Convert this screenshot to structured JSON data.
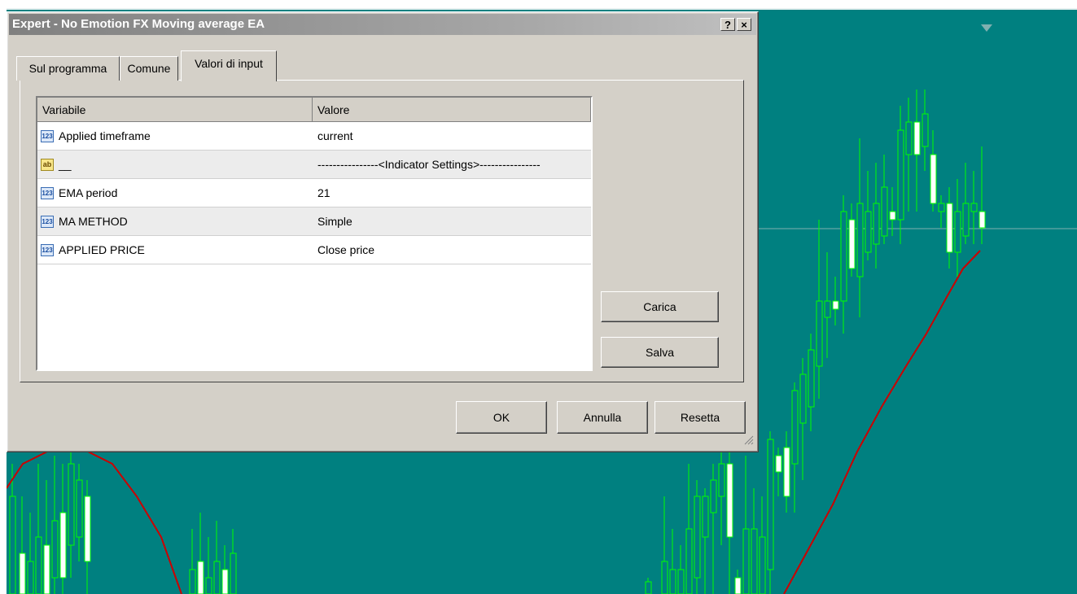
{
  "dialog": {
    "title": "Expert - No Emotion FX Moving average EA",
    "help_label": "?",
    "close_label": "×"
  },
  "tabs": [
    {
      "label": "Sul programma",
      "active": false
    },
    {
      "label": "Comune",
      "active": false
    },
    {
      "label": "Valori di input",
      "active": true
    }
  ],
  "grid": {
    "columns": [
      "Variabile",
      "Valore"
    ],
    "rows": [
      {
        "type_icon": "123",
        "variable": "Applied timeframe",
        "value": "current"
      },
      {
        "type_icon": "ab",
        "variable": "__",
        "value": "----------------<Indicator Settings>----------------"
      },
      {
        "type_icon": "123",
        "variable": "EMA period",
        "value": "21"
      },
      {
        "type_icon": "123",
        "variable": "MA METHOD",
        "value": "Simple"
      },
      {
        "type_icon": "123",
        "variable": "APPLIED PRICE",
        "value": "Close price"
      }
    ]
  },
  "side_buttons": {
    "load": "Carica",
    "save": "Salva"
  },
  "footer_buttons": {
    "ok": "OK",
    "cancel": "Annulla",
    "reset": "Resetta"
  },
  "colors": {
    "chart_bg": "#008080",
    "candle_color": "#00ff00",
    "ma_line": "#cc0000",
    "dialog_bg": "#d4d0c8"
  }
}
